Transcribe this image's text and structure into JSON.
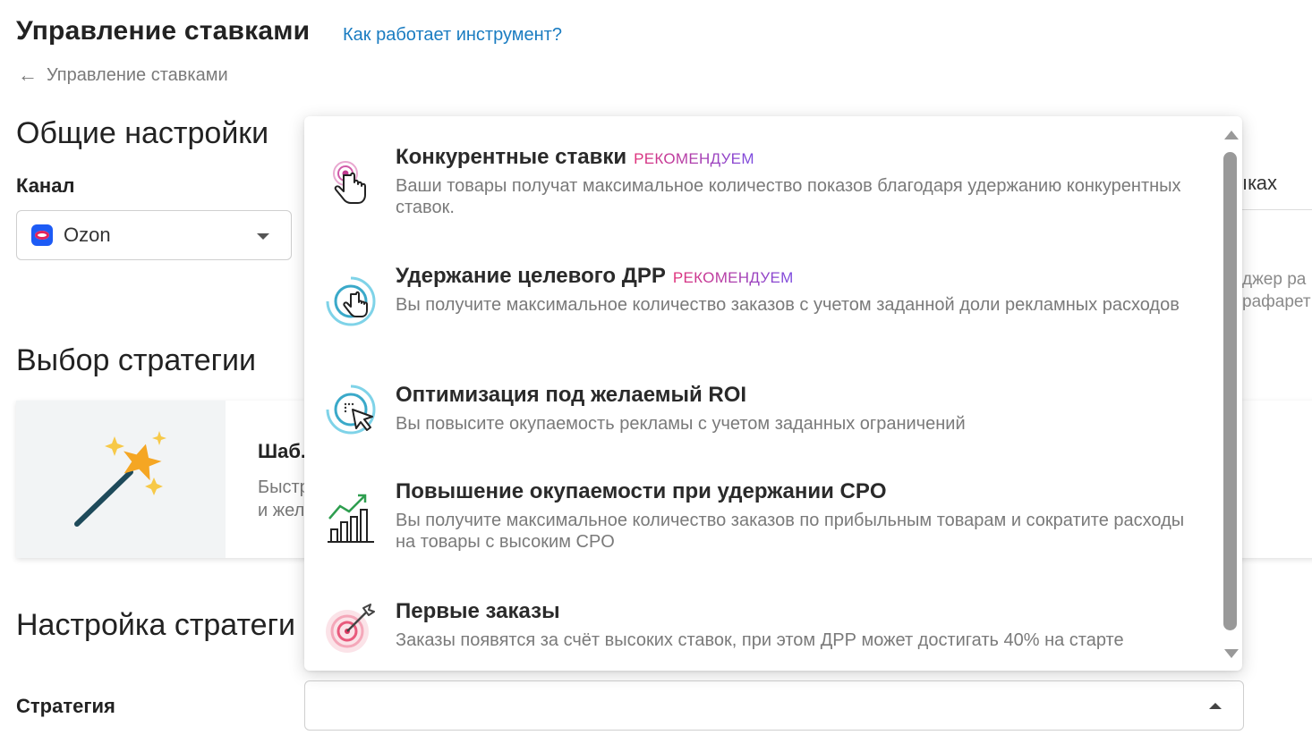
{
  "header": {
    "title": "Управление ставками",
    "help_link": "Как работает инструмент?",
    "breadcrumb": "Управление ставками"
  },
  "general": {
    "title": "Общие настройки",
    "channel_label": "Канал",
    "channel_value": "Ozon",
    "partial_right_label": "ıкax",
    "partial_right_text_1": "джер ра",
    "partial_right_text_2": "рафарет"
  },
  "strategy_choice": {
    "title": "Выбор стратегии",
    "card_title_partial": "Шаб.",
    "card_desc_line1": "Быстр",
    "card_desc_line2": "и жел"
  },
  "strategy_setup": {
    "title": "Настройка стратеги",
    "strategy_label": "Стратегия",
    "strategy_value": ""
  },
  "dropdown": {
    "options": [
      {
        "title": "Конкурентные ставки",
        "badge": "РЕКОМЕНДУЕМ",
        "description": "Ваши товары получат максимальное количество показов благодаря удержанию конкурентных ставок.",
        "icon": "tap-finger-icon"
      },
      {
        "title": "Удержание целевого ДРР",
        "badge": "РЕКОМЕНДУЕМ",
        "description": "Вы получите максимальное количество заказов с учетом заданной доли рекламных расходов",
        "icon": "target-hand-icon"
      },
      {
        "title": "Оптимизация под желаемый ROI",
        "badge": "",
        "description": "Вы повысите окупаемость рекламы с учетом заданных ограничений",
        "icon": "cursor-target-icon"
      },
      {
        "title": "Повышение окупаемости при удержании CPO",
        "badge": "",
        "description": "Вы получите максимальное количество заказов по прибыльным товарам и сократите расходы на товары с высоким CPO",
        "icon": "growth-chart-icon"
      },
      {
        "title": "Первые заказы",
        "badge": "",
        "description": "Заказы появятся за счёт высоких ставок, при этом ДРР может достигать 40% на старте",
        "icon": "dart-target-icon"
      }
    ]
  },
  "colors": {
    "link": "#1a7cc1",
    "badge_gradient_start": "#e0317a",
    "badge_gradient_end": "#7a4ae0",
    "ozon_brand": "#1d5bf5"
  }
}
